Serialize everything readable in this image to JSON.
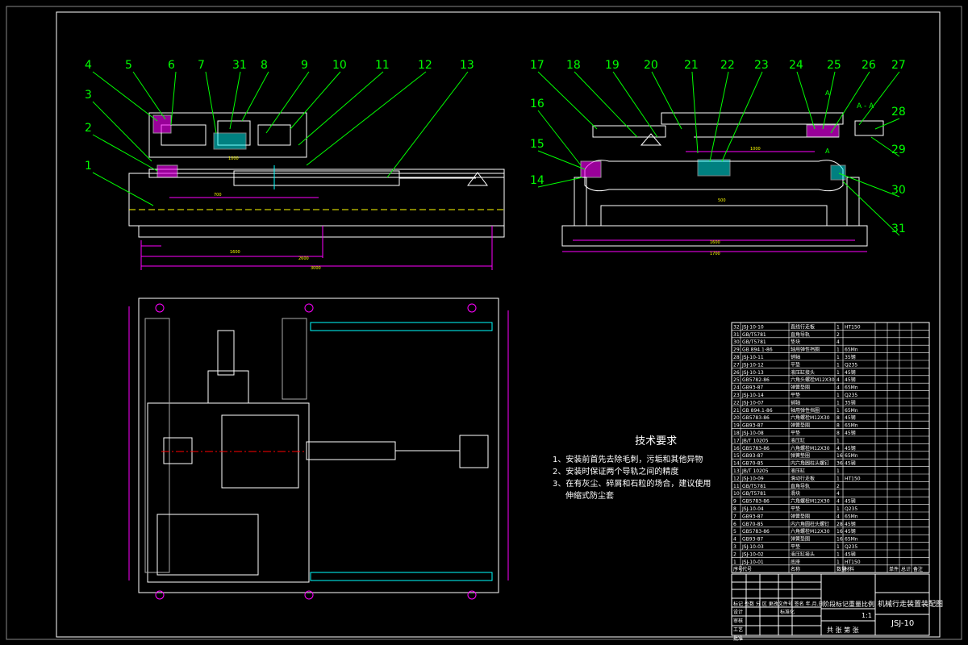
{
  "drawing": {
    "section_label": "A - A",
    "section_mark": "A",
    "balloons_front": [
      "4",
      "5",
      "6",
      "7",
      "31",
      "8",
      "9",
      "10",
      "11",
      "12",
      "13",
      "3",
      "2",
      "1"
    ],
    "balloons_side": [
      "17",
      "18",
      "19",
      "20",
      "21",
      "22",
      "23",
      "24",
      "25",
      "26",
      "27",
      "28",
      "29",
      "30",
      "31",
      "16",
      "15",
      "14"
    ],
    "dims_front": [
      "1600",
      "2600",
      "3000",
      "700",
      "1000"
    ],
    "dims_side": [
      "1600",
      "1700",
      "1000",
      "500"
    ],
    "colors": {
      "outline": "#ffffff",
      "callout": "#00ff00",
      "dimension": "#ff00ff",
      "centerline": "#ff0000",
      "hidden": "#ffff00",
      "accent": "#00ffff"
    }
  },
  "tech_requirements": {
    "heading": "技术要求",
    "items": [
      "1、安装前首先去除毛刺，污垢和其他异物",
      "2、安装时保证两个导轨之间的精度",
      "3、在有灰尘、碎屑和石粒的场合，建议使用",
      "伸缩式防尘套"
    ]
  },
  "bom": {
    "header": [
      "序号",
      "代号",
      "名称",
      "数量",
      "材料",
      "",
      "单件",
      "总计",
      "备注"
    ],
    "rows": [
      [
        "32",
        "JSJ-10-10",
        "直线行走板",
        "1",
        "HT150"
      ],
      [
        "31",
        "GB/T5781",
        "直角导轨",
        "2",
        ""
      ],
      [
        "30",
        "GB/T5781",
        "垫块",
        "4",
        ""
      ],
      [
        "29",
        "GB 894.1-86",
        "轴用弹性挡圈",
        "1",
        "65Mn"
      ],
      [
        "28",
        "JSJ-10-11",
        "销轴",
        "1",
        "35钢"
      ],
      [
        "27",
        "JSJ-10-12",
        "平垫",
        "1",
        "Q235"
      ],
      [
        "26",
        "JSJ-10-13",
        "液压缸接头",
        "1",
        "45钢"
      ],
      [
        "25",
        "GB5782-86",
        "六角头螺栓M12X30",
        "4",
        "45钢"
      ],
      [
        "24",
        "GB93-87",
        "弹簧垫圈",
        "4",
        "65Mn"
      ],
      [
        "23",
        "JSJ-10-14",
        "平垫",
        "1",
        "Q235"
      ],
      [
        "22",
        "JSJ-10-07",
        "销轴",
        "1",
        "35钢"
      ],
      [
        "21",
        "GB 894.1-86",
        "轴用弹性挡圈",
        "1",
        "65Mn"
      ],
      [
        "20",
        "GB5783-86",
        "六角螺栓M12X30",
        "8",
        "45钢"
      ],
      [
        "19",
        "GB93-87",
        "弹簧垫圈",
        "8",
        "65Mn"
      ],
      [
        "18",
        "JSJ-10-08",
        "平垫",
        "8",
        "45钢"
      ],
      [
        "17",
        "JB/T 10205",
        "液压缸",
        "1",
        ""
      ],
      [
        "16",
        "GB5783-86",
        "六角螺栓M12X30",
        "4",
        "45钢"
      ],
      [
        "15",
        "GB93-87",
        "弹簧垫圈",
        "16",
        "65Mn"
      ],
      [
        "14",
        "GB70-85",
        "内六角圆柱头螺钉",
        "36",
        "45钢"
      ],
      [
        "13",
        "JB/T 10205",
        "液压缸",
        "1",
        ""
      ],
      [
        "12",
        "JSJ-10-09",
        "滑动行走板",
        "1",
        "HT150"
      ],
      [
        "11",
        "GB/T5781",
        "直角导轨",
        "2",
        ""
      ],
      [
        "10",
        "GB/T5781",
        "滑块",
        "4",
        ""
      ],
      [
        "9",
        "GB5783-86",
        "六角螺栓M12X30",
        "4",
        "45钢"
      ],
      [
        "8",
        "JSJ-10-04",
        "平垫",
        "1",
        "Q235"
      ],
      [
        "7",
        "GB93-87",
        "弹簧垫圈",
        "4",
        "65Mn"
      ],
      [
        "6",
        "GB70-85",
        "内六角圆柱头螺钉",
        "28",
        "45钢"
      ],
      [
        "5",
        "GB5783-86",
        "六角螺栓M12X30",
        "16",
        "45钢"
      ],
      [
        "4",
        "GB93-87",
        "弹簧垫圈",
        "16",
        "65Mn"
      ],
      [
        "3",
        "JSJ-10-03",
        "平垫",
        "1",
        "Q235"
      ],
      [
        "2",
        "JSJ-10-02",
        "液压缸接头",
        "1",
        "45钢"
      ],
      [
        "1",
        "JSJ-10-01",
        "底座",
        "1",
        "HT150"
      ]
    ]
  },
  "title_block": {
    "title": "机械行走装置装配图",
    "drawing_no": "JSJ-10",
    "scale_label": "比例",
    "scale": "1:1",
    "weight_label": "重量",
    "stage_label": "阶段标记",
    "sheet": "共 张 第 张",
    "rev_labels": [
      "标记",
      "处数",
      "分 区",
      "更改文件号",
      "签名",
      "年.月.日"
    ],
    "roles": [
      "设计",
      "审核",
      "工艺",
      "批准"
    ],
    "std_label": "标准化"
  }
}
